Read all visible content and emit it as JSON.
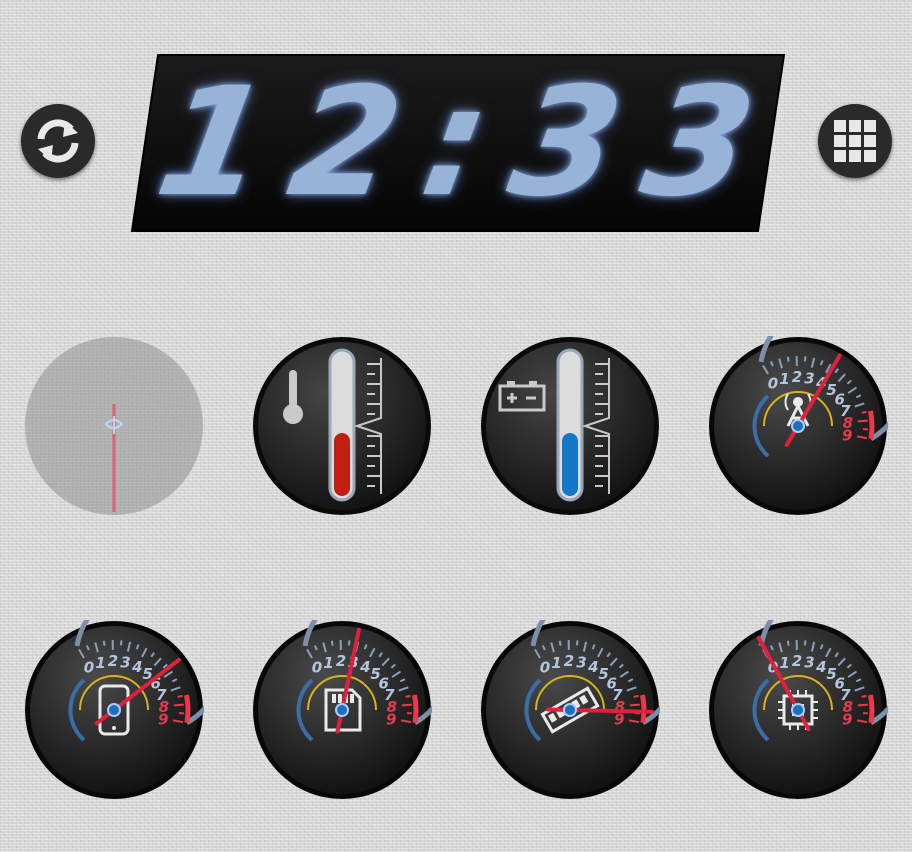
{
  "clock": {
    "time": "12:33"
  },
  "toolbar": {
    "refresh_icon": "refresh-icon",
    "grid_icon": "grid-icon"
  },
  "colors": {
    "needle": "#e0203c",
    "temperature_fill": "#c21f12",
    "battery_fill": "#1677c9",
    "digit_glow": "#97b3d6",
    "redline": "#e83a4a",
    "yellow_arc": "#d9b21f"
  },
  "thermometers": [
    {
      "name": "temperature",
      "icon": "thermometer-icon",
      "level": 0.45
    },
    {
      "name": "battery",
      "icon": "battery-icon",
      "level": 0.45
    }
  ],
  "gauges": {
    "scale_labels": [
      "0",
      "1",
      "2",
      "3",
      "4",
      "5",
      "6",
      "7",
      "8",
      "9"
    ],
    "items": [
      {
        "icon": "signal-tower-icon",
        "needle_value": 4.2
      },
      {
        "icon": "phone-icon",
        "needle_value": 5.7
      },
      {
        "icon": "sd-card-icon",
        "needle_value": 2.9
      },
      {
        "icon": "memory-card-icon",
        "needle_value": 8.4
      },
      {
        "icon": "cpu-chip-icon",
        "needle_value": 0.1
      }
    ]
  }
}
